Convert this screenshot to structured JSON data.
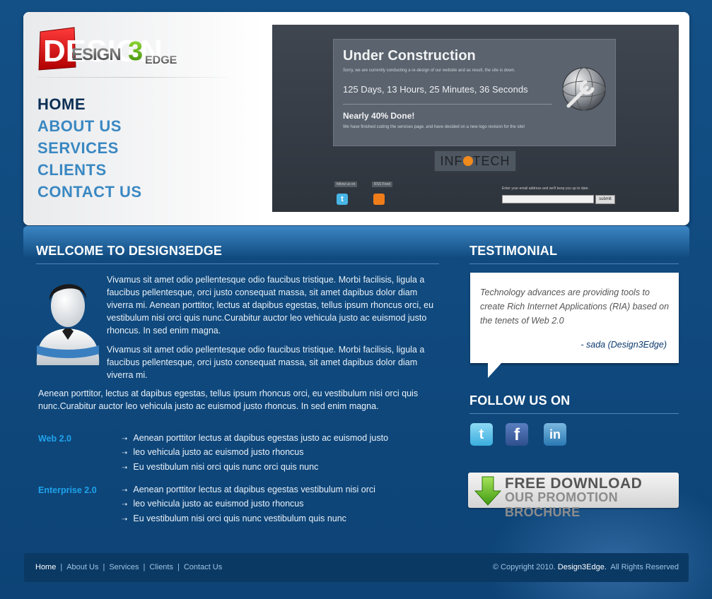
{
  "logo": {
    "text_main": "DESIGN",
    "text_num": "3",
    "text_edge": "EDGE"
  },
  "nav": [
    {
      "label": "HOME",
      "active": true
    },
    {
      "label": "ABOUT US"
    },
    {
      "label": "SERVICES"
    },
    {
      "label": "CLIENTS"
    },
    {
      "label": "CONTACT US"
    }
  ],
  "banner": {
    "title": "Under Construction",
    "subtitle": "Sorry, we are currently conducting a re-design of our website and as result, the site is down.",
    "countdown": "125 Days, 13 Hours, 25 Minutes, 36 Seconds",
    "progress_label": "Nearly 40% Done!",
    "progress_fraction": 0.4,
    "note": "We have finished coding the services page, and have decided on a new logo revision for the site!",
    "brand_left": "INF",
    "brand_right": "TECH",
    "follow_label": "follow us on",
    "rss_label": "RSS Feed",
    "email_label": "Enter your email address and we'll keep you up to date.",
    "submit_label": "submit",
    "twitter_icon": "twitter-icon",
    "rss_icon": "rss-icon"
  },
  "welcome": {
    "heading": "WELCOME TO DESIGN3EDGE",
    "para1": "Vivamus sit amet odio pellentesque odio faucibus tristique. Morbi facilisis, ligula a faucibus pellentesque, orci justo consequat massa, sit amet dapibus dolor diam viverra mi. Aenean porttitor, lectus at dapibus egestas, tellus ipsum rhoncus orci, eu vestibulum nisi orci quis nunc.Curabitur auctor leo vehicula justo ac euismod justo rhoncus. In sed enim magna.",
    "para2": "Vivamus sit amet odio pellentesque odio faucibus tristique. Morbi facilisis, ligula a faucibus pellentesque, orci justo consequat massa, sit amet dapibus dolor diam viverra mi.",
    "para3": "Aenean porttitor, lectus at dapibus egestas, tellus ipsum rhoncus orci, eu vestibulum nisi orci quis nunc.Curabitur auctor leo vehicula justo ac euismod justo rhoncus. In sed enim magna.",
    "lists": [
      {
        "label": "Web 2.0",
        "items": [
          "Aenean porttitor lectus at dapibus egestas justo ac euismod justo",
          "leo vehicula justo ac euismod justo rhoncus",
          "Eu vestibulum nisi orci quis nunc orci quis nunc"
        ]
      },
      {
        "label": "Enterprise 2.0",
        "items": [
          "Aenean porttitor lectus at dapibus egestas vestibulum nisi orci",
          "leo vehicula justo ac euismod justo rhoncus",
          "Eu vestibulum nisi orci quis nunc vestibulum quis nunc"
        ]
      }
    ],
    "arrow": "➝"
  },
  "testimonial": {
    "heading": "TESTIMONIAL",
    "quote": "Technology advances are providing tools to create Rich Internet Applications (RIA) based on the tenets of Web 2.0",
    "author": "- sada (Design3Edge)"
  },
  "follow": {
    "heading": "FOLLOW US ON",
    "twitter_glyph": "t",
    "facebook_glyph": "f",
    "linkedin_glyph": "in"
  },
  "download": {
    "line1": "FREE DOWNLOAD",
    "line2": "OUR PROMOTION BROCHURE"
  },
  "footer": {
    "links": [
      "Home",
      "About Us",
      "Services",
      "Clients",
      "Contact Us"
    ],
    "separator": "|",
    "copyright_prefix": "© Copyright 2010.",
    "copyright_brand": "Design3Edge.",
    "copyright_suffix": "All Rights Reserved"
  },
  "colors": {
    "page_bg": "#0f4a7c",
    "nav_active": "#0b2f55",
    "nav_link": "#3a88c2",
    "list_label": "#1fa3ec",
    "footer_bg": "#0a3964"
  }
}
